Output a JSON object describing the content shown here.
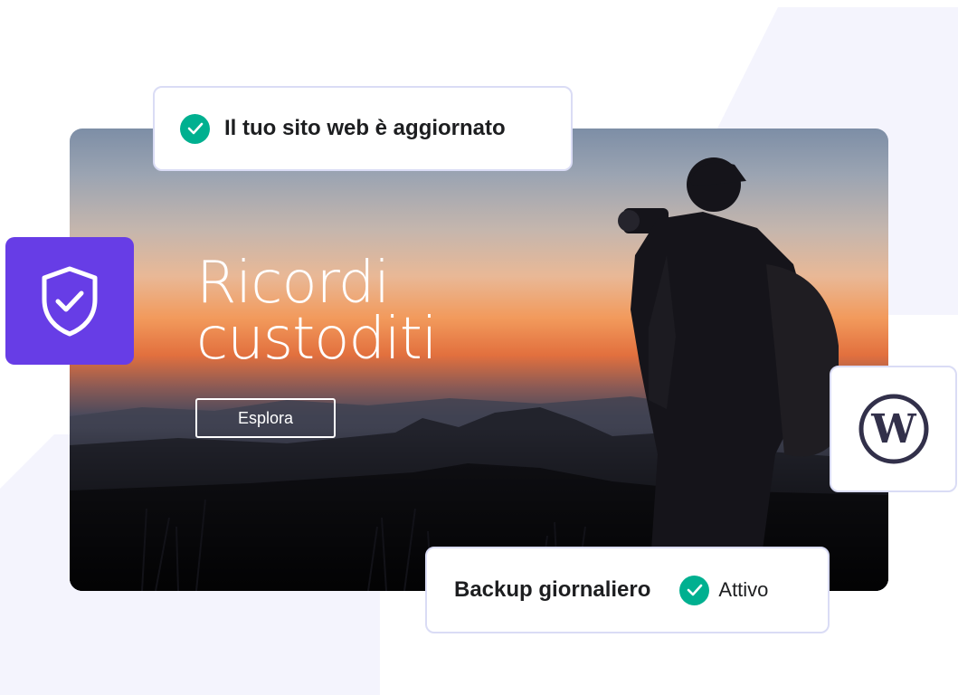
{
  "hero": {
    "title_line1": "Ricordi",
    "title_line2": "custoditi",
    "button_label": "Esplora"
  },
  "update_card": {
    "text": "Il tuo sito web è aggiornato",
    "icon": "check-circle-icon"
  },
  "backup_card": {
    "label": "Backup giornaliero",
    "status": "Attivo",
    "icon": "check-circle-icon"
  },
  "tiles": {
    "security_icon": "shield-check-icon",
    "platform_icon": "wordpress-icon"
  },
  "colors": {
    "brand_purple": "#673de6",
    "check_green": "#00b090",
    "card_border": "#dadcf5",
    "background_shape": "#f4f4fd",
    "wordpress_navy": "#32304a"
  }
}
